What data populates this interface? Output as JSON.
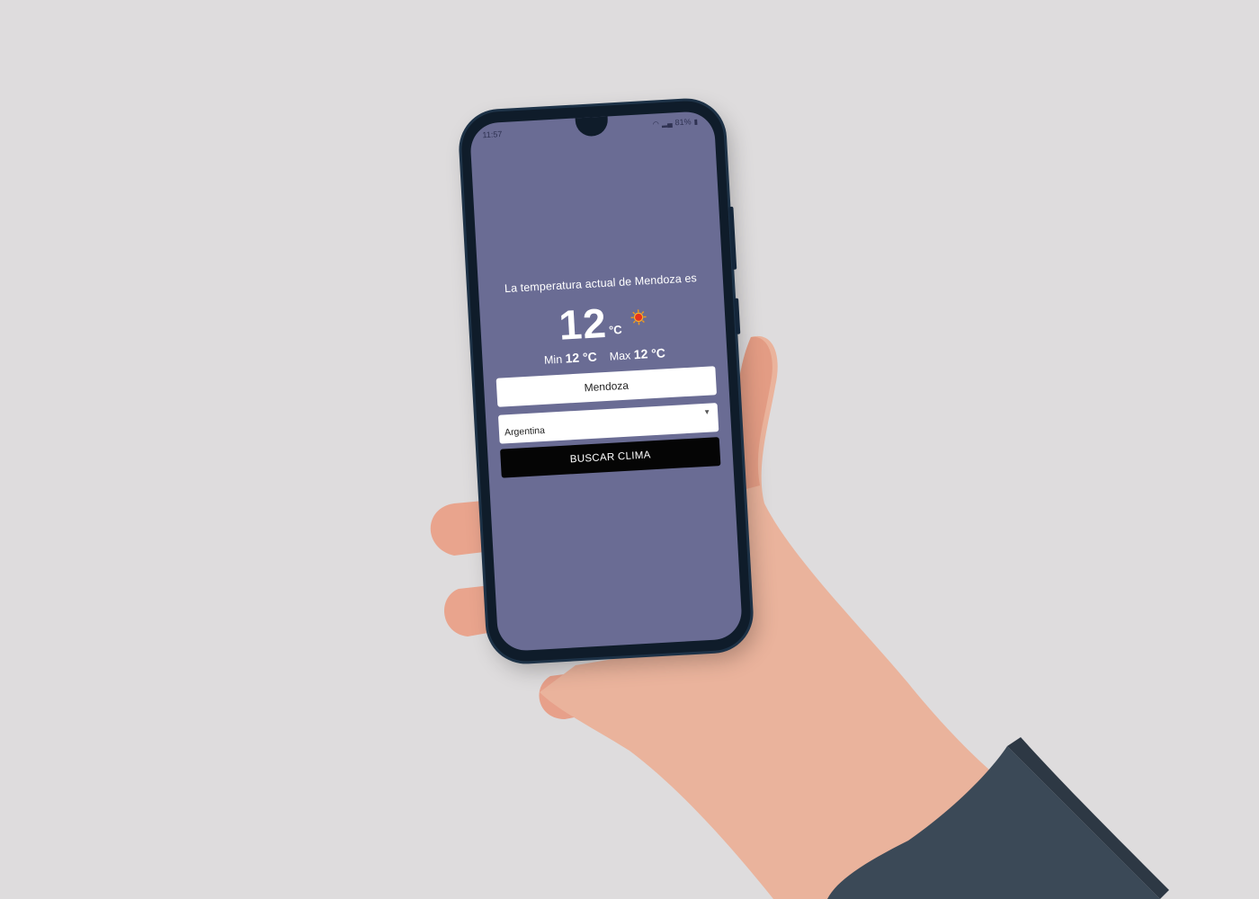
{
  "status_bar": {
    "time": "11:57",
    "battery": "81%"
  },
  "weather": {
    "heading": "La temperatura actual de Mendoza es",
    "temperature": "12",
    "unit": "°C",
    "icon": "sun-icon",
    "min_label": "Min",
    "min_value": "12 °C",
    "max_label": "Max",
    "max_value": "12 °C"
  },
  "form": {
    "city_value": "Mendoza",
    "country_value": "Argentina",
    "search_label": "BUSCAR CLIMA"
  },
  "colors": {
    "screen_bg": "#6a6c94",
    "button_bg": "#050505",
    "background": "#dedcdd"
  }
}
